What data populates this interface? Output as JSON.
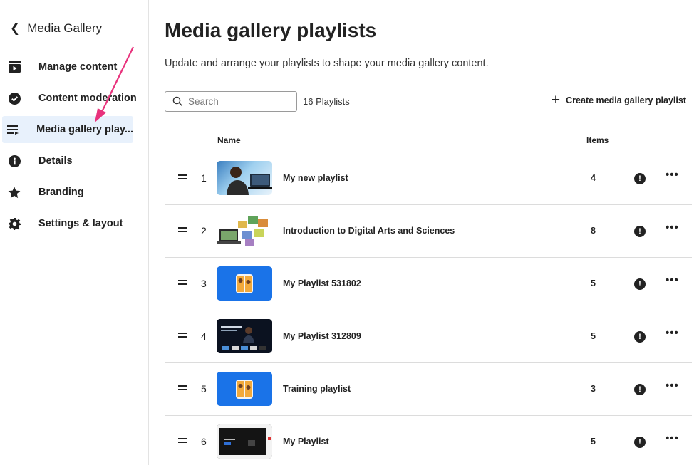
{
  "sidebar": {
    "back_label": "Media Gallery",
    "items": [
      {
        "label": "Manage content",
        "icon": "play-square-icon"
      },
      {
        "label": "Content moderation",
        "icon": "check-circle-icon"
      },
      {
        "label": "Media gallery play...",
        "icon": "playlist-icon"
      },
      {
        "label": "Details",
        "icon": "info-icon"
      },
      {
        "label": "Branding",
        "icon": "star-icon"
      },
      {
        "label": "Settings & layout",
        "icon": "gear-icon"
      }
    ],
    "active_index": 2
  },
  "header": {
    "title": "Media gallery playlists",
    "subtitle": "Update and arrange your playlists to shape your media gallery content."
  },
  "toolbar": {
    "search_placeholder": "Search",
    "count": "16 Playlists",
    "create_label": "Create media gallery playlist"
  },
  "table": {
    "columns": {
      "name": "Name",
      "items": "Items"
    },
    "rows": [
      {
        "num": "1",
        "name": "My new playlist",
        "items": "4"
      },
      {
        "num": "2",
        "name": "Introduction to Digital Arts and Sciences",
        "items": "8"
      },
      {
        "num": "3",
        "name": "My Playlist 531802",
        "items": "5"
      },
      {
        "num": "4",
        "name": "My Playlist 312809",
        "items": "5"
      },
      {
        "num": "5",
        "name": "Training playlist",
        "items": "3"
      },
      {
        "num": "6",
        "name": "My Playlist",
        "items": "5"
      }
    ]
  },
  "colors": {
    "active_nav_bg": "#e8f1fc",
    "annotation_arrow": "#e8327c",
    "border": "#dcdcdc"
  }
}
